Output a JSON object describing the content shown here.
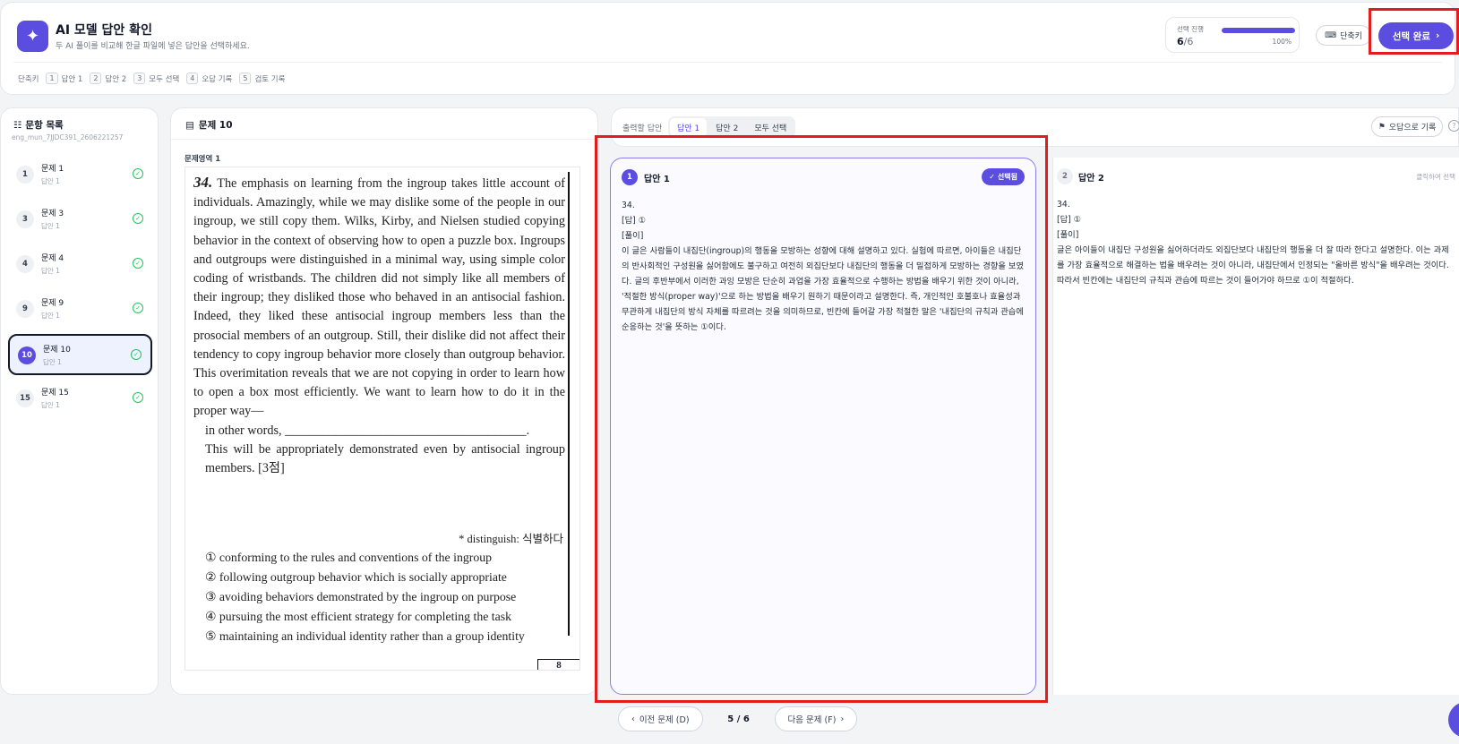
{
  "header": {
    "title": "AI 모델 답안 확인",
    "subtitle": "두 AI 풀이를 비교해 한글 파일에 넣은 답안을 선택하세요.",
    "progress_label": "선택 진행",
    "progress_done": "6",
    "progress_total": "/6",
    "progress_fraction": 1.0,
    "progress_percent": "100%",
    "shortcut_button": "단축키",
    "done_button": "선택 완료"
  },
  "shortcuts": {
    "label": "단축키",
    "items": [
      {
        "key": "1",
        "label": "답안 1"
      },
      {
        "key": "2",
        "label": "답안 2"
      },
      {
        "key": "3",
        "label": "모두 선택"
      },
      {
        "key": "4",
        "label": "오답 기록"
      },
      {
        "key": "5",
        "label": "검토 기록"
      }
    ]
  },
  "sidebar": {
    "title": "문항 목록",
    "file_id": "eng_mun_7JJDC391_2606221257",
    "items": [
      {
        "num": "1",
        "name": "문제 1",
        "sub": "답안 1"
      },
      {
        "num": "3",
        "name": "문제 3",
        "sub": "답안 1"
      },
      {
        "num": "4",
        "name": "문제 4",
        "sub": "답안 1"
      },
      {
        "num": "9",
        "name": "문제 9",
        "sub": "답안 1"
      },
      {
        "num": "10",
        "name": "문제 10",
        "sub": "답안 1"
      },
      {
        "num": "15",
        "name": "문제 15",
        "sub": "답안 1"
      }
    ]
  },
  "question": {
    "title": "문제 10",
    "section": "문제영역 1",
    "number": "34.",
    "passage_1": "The emphasis on learning from the ingroup takes little account of individuals. Amazingly, while we may dislike some of the people in our ingroup, we still copy them. Wilks, Kirby, and Nielsen studied copying behavior in the context of observing how to open a puzzle box. Ingroups and outgroups were distinguished in a minimal way, using simple color coding of wristbands. The children did not simply like all members of their ingroup; they disliked those who behaved in an antisocial fashion. Indeed, they liked these antisocial ingroup members less than the prosocial members of an outgroup. Still, their dislike did not affect their tendency to copy ingroup behavior more closely than outgroup behavior. This overimitation reveals that we are not copying in order to learn how to open a box most efficiently. We want to learn how to do it in the proper way—",
    "passage_2": "in other words, ______________________________________.",
    "passage_3": "This will be appropriately demonstrated even by antisocial ingroup members. [3점]",
    "footnote": "* distinguish: 식별하다",
    "choices": [
      "① conforming to the rules and conventions of the ingroup",
      "② following outgroup behavior which is socially appropriate",
      "③ avoiding behaviors demonstrated by the ingroup on purpose",
      "④ pursuing the most efficient strategy for completing the task",
      "⑤ maintaining an individual identity rather than a group identity"
    ],
    "page_box": "8"
  },
  "answers": {
    "tabs_label": "출력할 답안",
    "tabs": [
      "답안 1",
      "답안 2",
      "모두 선택"
    ],
    "wrong_button": "오답으로 기록",
    "help": "?",
    "a1": {
      "num": "1",
      "title": "답안 1",
      "badge": "선택됨",
      "line1": "34.",
      "line2": "[답] ①",
      "line3": "[풀이]",
      "body": "이 글은 사람들이 내집단(ingroup)의 행동을 모방하는 성향에 대해 설명하고 있다. 실험에 따르면, 아이들은 내집단의 반사회적인 구성원을 싫어함에도 불구하고 여전히 외집단보다 내집단의 행동을 더 밀접하게 모방하는 경향을 보였다. 글의 후반부에서 이러한 과잉 모방은 단순히 과업을 가장 효율적으로 수행하는 방법을 배우기 위한 것이 아니라, '적절한 방식(proper way)'으로 하는 방법을 배우기 원하기 때문이라고 설명한다. 즉, 개인적인 호불호나 효율성과 무관하게 내집단의 방식 자체를 따르려는 것을 의미하므로, 빈칸에 들어갈 가장 적절한 말은 '내집단의 규칙과 관습에 순응하는 것'을 뜻하는 ①이다."
    },
    "a2": {
      "num": "2",
      "title": "답안 2",
      "hint": "클릭하여 선택",
      "line1": "34.",
      "line2": "[답] ①",
      "line3": "[풀이]",
      "body": "글은 아이들이 내집단 구성원을 싫어하더라도 외집단보다 내집단의 행동을 더 잘 따라 한다고 설명한다. 이는 과제를 가장 효율적으로 해결하는 법을 배우려는 것이 아니라, 내집단에서 인정되는 \"올바른 방식\"을 배우려는 것이다. 따라서 빈칸에는 내집단의 규칙과 관습에 따르는 것이 들어가야 하므로 ①이 적절하다."
    }
  },
  "pager": {
    "prev": "이전 문제 (D)",
    "count": "5 / 6",
    "next": "다음 문제 (F)"
  },
  "colors": {
    "accent": "#5b4de0",
    "highlight": "#e11d1d",
    "check": "#22c55e"
  }
}
